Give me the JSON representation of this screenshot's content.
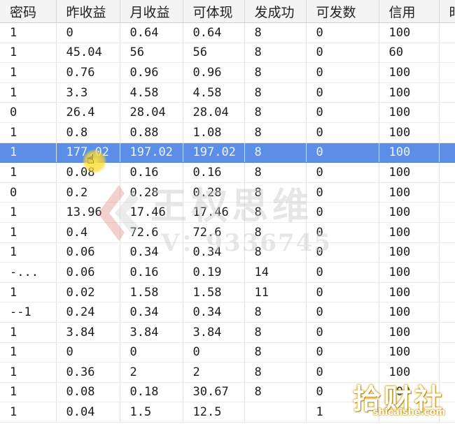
{
  "table": {
    "columns": [
      "密码",
      "昨收益",
      "月收益",
      "可体现",
      "发成功",
      "可发数",
      "信用",
      "时"
    ],
    "rows": [
      [
        "1",
        "0",
        "0.64",
        "0.64",
        "8",
        "0",
        "100",
        ""
      ],
      [
        "1",
        "45.04",
        "56",
        "56",
        "8",
        "0",
        "60",
        ""
      ],
      [
        "1",
        "0.76",
        "0.96",
        "0.96",
        "8",
        "0",
        "100",
        ""
      ],
      [
        "1",
        "3.3",
        "4.58",
        "4.58",
        "8",
        "0",
        "100",
        ""
      ],
      [
        "0",
        "26.4",
        "28.04",
        "28.04",
        "8",
        "0",
        "100",
        ""
      ],
      [
        "1",
        "0.8",
        "0.88",
        "1.08",
        "8",
        "0",
        "100",
        ""
      ],
      [
        "1",
        "177.02",
        "197.02",
        "197.02",
        "8",
        "0",
        "100",
        ""
      ],
      [
        "1",
        "0.08",
        "0.16",
        "0.16",
        "8",
        "0",
        "100",
        ""
      ],
      [
        "0",
        "0.2",
        "0.28",
        "0.28",
        "8",
        "0",
        "100",
        ""
      ],
      [
        "1",
        "13.96",
        "17.46",
        "17.46",
        "8",
        "0",
        "100",
        ""
      ],
      [
        "1",
        "0.4",
        "72.6",
        "72.6",
        "8",
        "0",
        "100",
        ""
      ],
      [
        "1",
        "0.06",
        "0.34",
        "0.34",
        "8",
        "0",
        "100",
        ""
      ],
      [
        "-...",
        "0.06",
        "0.16",
        "0.19",
        "14",
        "0",
        "100",
        ""
      ],
      [
        "1",
        "0.02",
        "1.58",
        "1.58",
        "11",
        "0",
        "100",
        ""
      ],
      [
        "--1",
        "0.24",
        "0.34",
        "0.34",
        "8",
        "0",
        "100",
        ""
      ],
      [
        "1",
        "3.84",
        "3.84",
        "3.84",
        "8",
        "0",
        "100",
        ""
      ],
      [
        "1",
        "0",
        "0",
        "0",
        "8",
        "0",
        "100",
        ""
      ],
      [
        "1",
        "0.36",
        "2",
        "2",
        "8",
        "0",
        "100",
        ""
      ],
      [
        "1",
        "0.08",
        "0.18",
        "30.67",
        "8",
        "0",
        "100",
        ""
      ],
      [
        "1",
        "0.04",
        "1.5",
        "12.5",
        "",
        "1",
        "",
        ""
      ]
    ],
    "selected_row": 6
  },
  "watermark": {
    "line1": "王权思维",
    "line2": "V：9336745"
  },
  "brand": {
    "main": "拾财社",
    "url": "shicaishe.com"
  },
  "colors": {
    "selection": "#5b8ee6",
    "header_bg": "#f4f4f4",
    "brand_outline": "#c79300"
  }
}
